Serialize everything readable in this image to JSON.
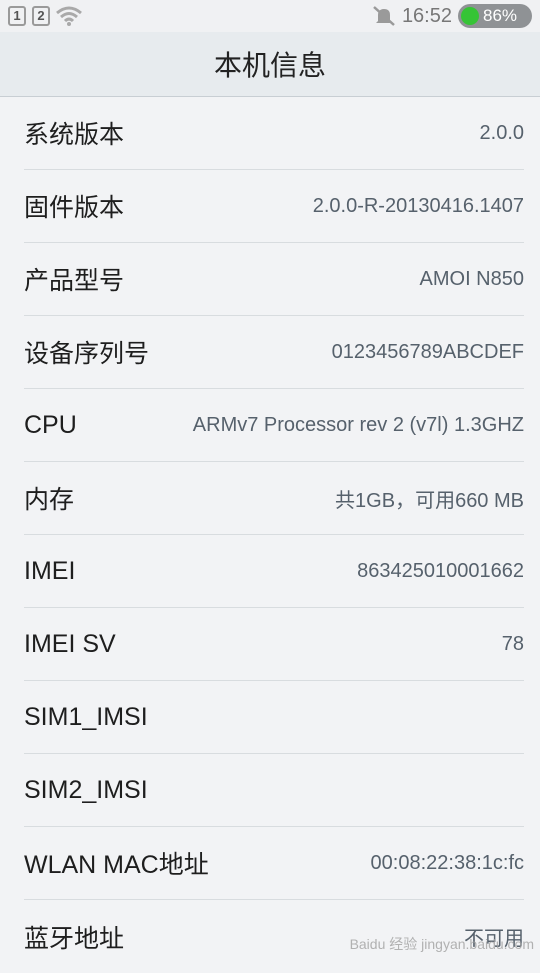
{
  "status_bar": {
    "sim1": "1",
    "sim2": "2",
    "time": "16:52",
    "battery": "86%",
    "battery_color": "#36c436"
  },
  "header": {
    "title": "本机信息"
  },
  "items": [
    {
      "label": "系统版本",
      "value": "2.0.0"
    },
    {
      "label": "固件版本",
      "value": "2.0.0-R-20130416.1407"
    },
    {
      "label": "产品型号",
      "value": "AMOI N850"
    },
    {
      "label": "设备序列号",
      "value": "0123456789ABCDEF"
    },
    {
      "label": "CPU",
      "value": "ARMv7 Processor rev 2 (v7l) 1.3GHZ"
    },
    {
      "label": "内存",
      "value": "共1GB，可用660 MB"
    },
    {
      "label": "IMEI",
      "value": "863425010001662"
    },
    {
      "label": "IMEI SV",
      "value": "78"
    },
    {
      "label": "SIM1_IMSI",
      "value": ""
    },
    {
      "label": "SIM2_IMSI",
      "value": ""
    },
    {
      "label": "WLAN MAC地址",
      "value": "00:08:22:38:1c:fc"
    },
    {
      "label": "蓝牙地址",
      "value": "不可用"
    }
  ],
  "watermark": "Baidu 经验 jingyan.baidu.com"
}
